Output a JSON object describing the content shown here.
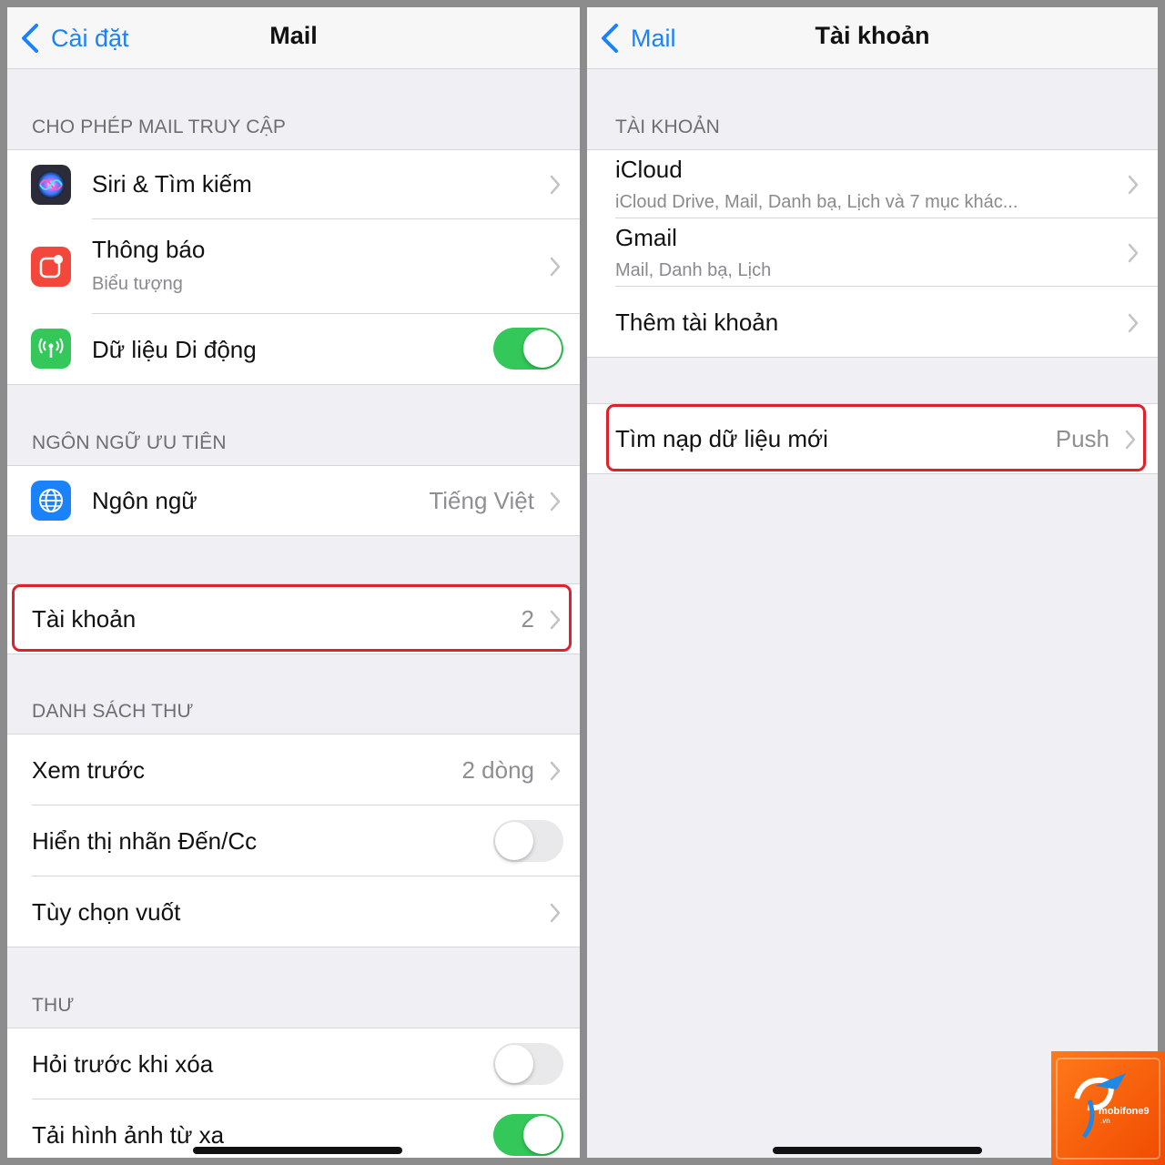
{
  "left": {
    "nav": {
      "back_label": "Cài đặt",
      "title": "Mail"
    },
    "sections": {
      "allow": {
        "header": "CHO PHÉP MAIL TRUY CẬP",
        "siri": "Siri & Tìm kiếm",
        "notifications": "Thông báo",
        "notifications_sub": "Biểu tượng",
        "cellular": "Dữ liệu Di động",
        "cellular_on": true
      },
      "language": {
        "header": "NGÔN NGỮ ƯU TIÊN",
        "label": "Ngôn ngữ",
        "value": "Tiếng Việt"
      },
      "accounts": {
        "label": "Tài khoản",
        "value": "2"
      },
      "message_list": {
        "header": "DANH SÁCH THƯ",
        "preview": "Xem trước",
        "preview_value": "2 dòng",
        "show_to_cc": "Hiển thị nhãn Đến/Cc",
        "show_to_cc_on": false,
        "swipe": "Tùy chọn vuốt"
      },
      "messages": {
        "header": "THƯ",
        "ask_delete": "Hỏi trước khi xóa",
        "ask_delete_on": false,
        "load_remote": "Tải hình ảnh từ xa",
        "load_remote_on": true
      }
    }
  },
  "right": {
    "nav": {
      "back_label": "Mail",
      "title": "Tài khoản"
    },
    "accounts_header": "TÀI KHOẢN",
    "accounts": [
      {
        "name": "iCloud",
        "detail": "iCloud Drive, Mail, Danh bạ, Lịch và 7 mục khác..."
      },
      {
        "name": "Gmail",
        "detail": "Mail, Danh bạ, Lịch"
      }
    ],
    "add_account": "Thêm tài khoản",
    "fetch": {
      "label": "Tìm nạp dữ liệu mới",
      "value": "Push"
    }
  },
  "watermark": {
    "brand": "mobifone9",
    "domain": ".vn"
  },
  "colors": {
    "accent": "#1a82fb",
    "toggle_on": "#34c759",
    "highlight": "#e0202a",
    "siri_icon_bg": "#2b2b3a",
    "notifications_icon_bg": "#f2473a",
    "cellular_icon_bg": "#34c759",
    "language_icon_bg": "#1a82fb"
  },
  "icons": {
    "back": "chevron-left-icon",
    "disclosure": "chevron-right-icon",
    "siri": "siri-icon",
    "notifications": "notifications-icon",
    "cellular": "cellular-antenna-icon",
    "language": "globe-icon"
  }
}
